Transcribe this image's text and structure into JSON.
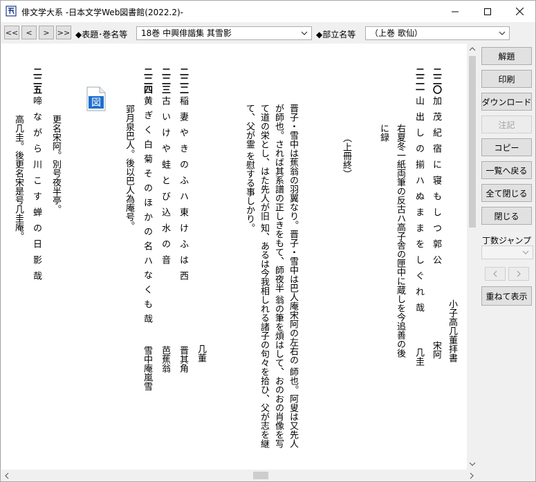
{
  "window": {
    "title": "俳文学大系  -日本文学Web図書館(2022.2)-",
    "app_icon": "book-icon"
  },
  "toolbar": {
    "nav": [
      "<<",
      "<",
      ">",
      ">>"
    ],
    "title_label": "◆表題･巻名等",
    "title_value": "18巻  中興俳諧集  其雪影",
    "section_label": "◆部立名等",
    "section_value": "（上巻  歌仙）"
  },
  "side": {
    "commentary": "解題",
    "print": "印刷",
    "download": "ダウンロード",
    "notes": "注記",
    "copy": "コピー",
    "back_to_list": "一覧へ戻る",
    "close_all": "全て閉じる",
    "close": "閉じる",
    "jump_label": "丁数ジャンプ",
    "overlay": "重ねて表示"
  },
  "content": {
    "right_author": "小子高几董拝書",
    "n220": "二二〇",
    "v220": "加茂紀宿に寝もしつ郭公",
    "a220": "宋阿",
    "n221": "二二一",
    "v221": "山出しの揃ハぬままをしぐれ哉",
    "a221": "几圭",
    "note1": "右夏冬一紙両筆の反古ハ高子舎の匣中に蔵しを今追善の後",
    "note2": "に録",
    "end_mark": "（上冊終）",
    "prose1": "晋子・雪中は蕉翁の羽翼なり。晋子・雪中は巴人庵宋阿の左右の",
    "prose2": "師也。阿叟は又先人が師也。されば其系譜の正しきをもて、師夜半",
    "prose3": "翁の筆を煩はして、おのおの肖像を写て道の栄とし、はた先人が旧",
    "prose4": "知、あるは今我相しれる諸子の句々を拾ひ、父が志を継て、父が霊",
    "prose5": "を慰する事しかり。",
    "sign": "几董",
    "n222": "二二二",
    "v222": "稲妻やきのふハ東けふは西",
    "a222": "晋其角",
    "n223": "二二三",
    "v223": "古いけや蛙とび込水の音",
    "a223": "芭蕉翁",
    "n224": "二二四",
    "v224": "黄ぎく白菊そのほかの名ハなくも哉",
    "a224": "雪中庵嵐雪",
    "note224": "郢月泉巴人。後以巴人為庵号。",
    "note_b1": "更名宋阿。別号夜半亭。",
    "n225": "二二五",
    "v225": "啼ながら川こす蝉の日影哉",
    "note_b2": "高几圭。後更名宋是号几圭庵。",
    "fig_label": "図"
  }
}
